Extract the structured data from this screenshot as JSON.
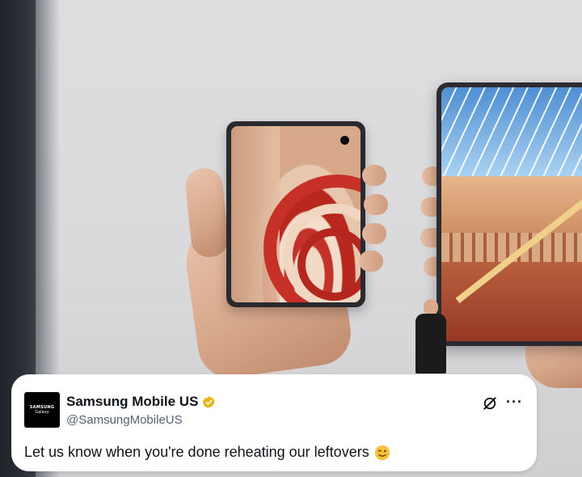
{
  "tweet": {
    "avatar": {
      "line1": "SAMSUNG",
      "line2": "Galaxy"
    },
    "name": "Samsung Mobile US",
    "handle": "@SamsungMobileUS",
    "text": "Let us know when you're done reheating our leftovers",
    "icons": {
      "verified": "verified-badge-icon",
      "grok": "grok-icon",
      "more": "more-options-icon",
      "emoji": "winking-face-emoji"
    },
    "colors": {
      "verified": "#e2b719",
      "text": "#0f1419",
      "muted": "#536471"
    }
  }
}
